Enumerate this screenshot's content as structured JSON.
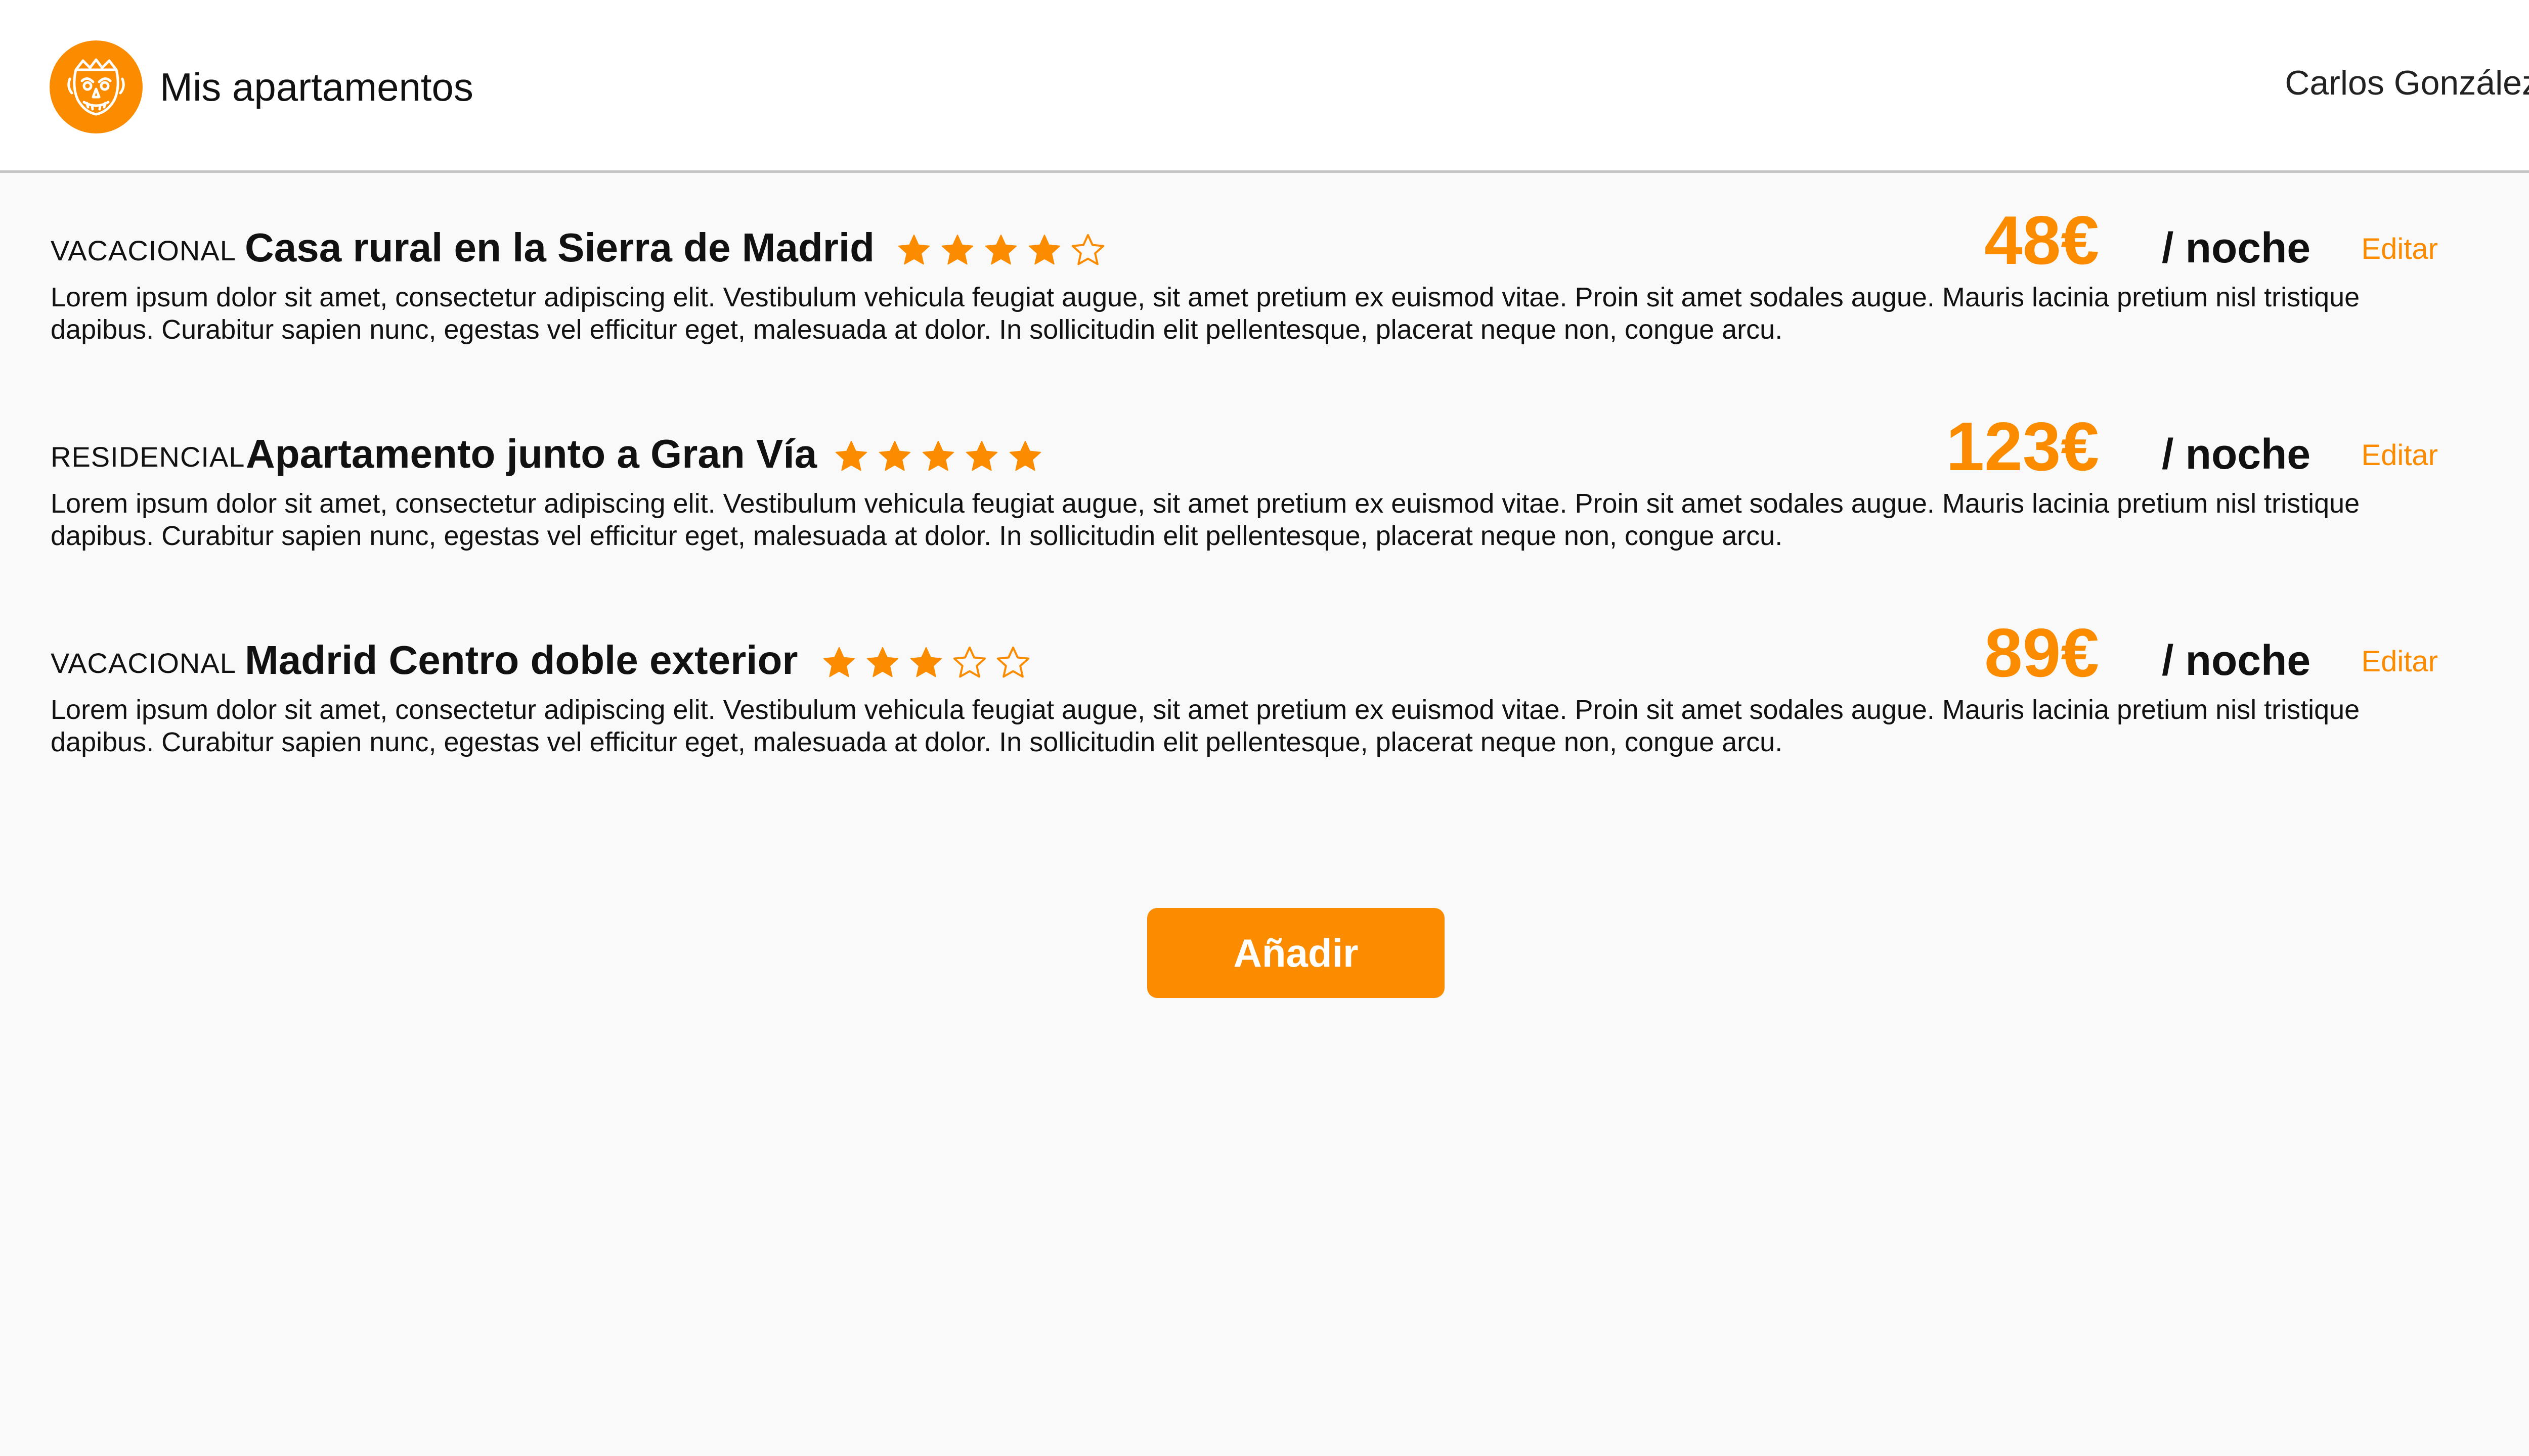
{
  "header": {
    "title": "Mis apartamentos",
    "user_name": "Carlos González",
    "logo_icon": "mask-face-icon"
  },
  "colors": {
    "accent": "#fb8c00",
    "text": "#111111",
    "background": "#f9f9f9",
    "header_background": "#ffffff"
  },
  "listings": [
    {
      "category": "VACACIONAL",
      "name": "Casa rural en la Sierra de Madrid",
      "rating": 4,
      "max_rating": 5,
      "price": "48€",
      "price_unit": "/ noche",
      "edit_label": "Editar",
      "description": "Lorem ipsum dolor sit amet, consectetur adipiscing elit. Vestibulum vehicula feugiat augue, sit amet pretium ex euismod vitae. Proin sit amet sodales augue. Mauris lacinia pretium nisl tristique dapibus. Curabitur sapien nunc, egestas vel efficitur eget, malesuada at dolor. In sollicitudin elit pellentesque, placerat neque non, congue arcu."
    },
    {
      "category": "RESIDENCIAL",
      "name": "Apartamento junto a Gran Vía",
      "rating": 5,
      "max_rating": 5,
      "price": "123€",
      "price_unit": "/ noche",
      "edit_label": "Editar",
      "description": "Lorem ipsum dolor sit amet, consectetur adipiscing elit. Vestibulum vehicula feugiat augue, sit amet pretium ex euismod vitae. Proin sit amet sodales augue. Mauris lacinia pretium nisl tristique dapibus. Curabitur sapien nunc, egestas vel efficitur eget, malesuada at dolor. In sollicitudin elit pellentesque, placerat neque non, congue arcu."
    },
    {
      "category": "VACACIONAL",
      "name": "Madrid Centro doble exterior",
      "rating": 3,
      "max_rating": 5,
      "price": "89€",
      "price_unit": "/ noche",
      "edit_label": "Editar",
      "description": "Lorem ipsum dolor sit amet, consectetur adipiscing elit. Vestibulum vehicula feugiat augue, sit amet pretium ex euismod vitae. Proin sit amet sodales augue. Mauris lacinia pretium nisl tristique dapibus. Curabitur sapien nunc, egestas vel efficitur eget, malesuada at dolor. In sollicitudin elit pellentesque, placerat neque non, congue arcu."
    }
  ],
  "actions": {
    "add_label": "Añadir"
  }
}
